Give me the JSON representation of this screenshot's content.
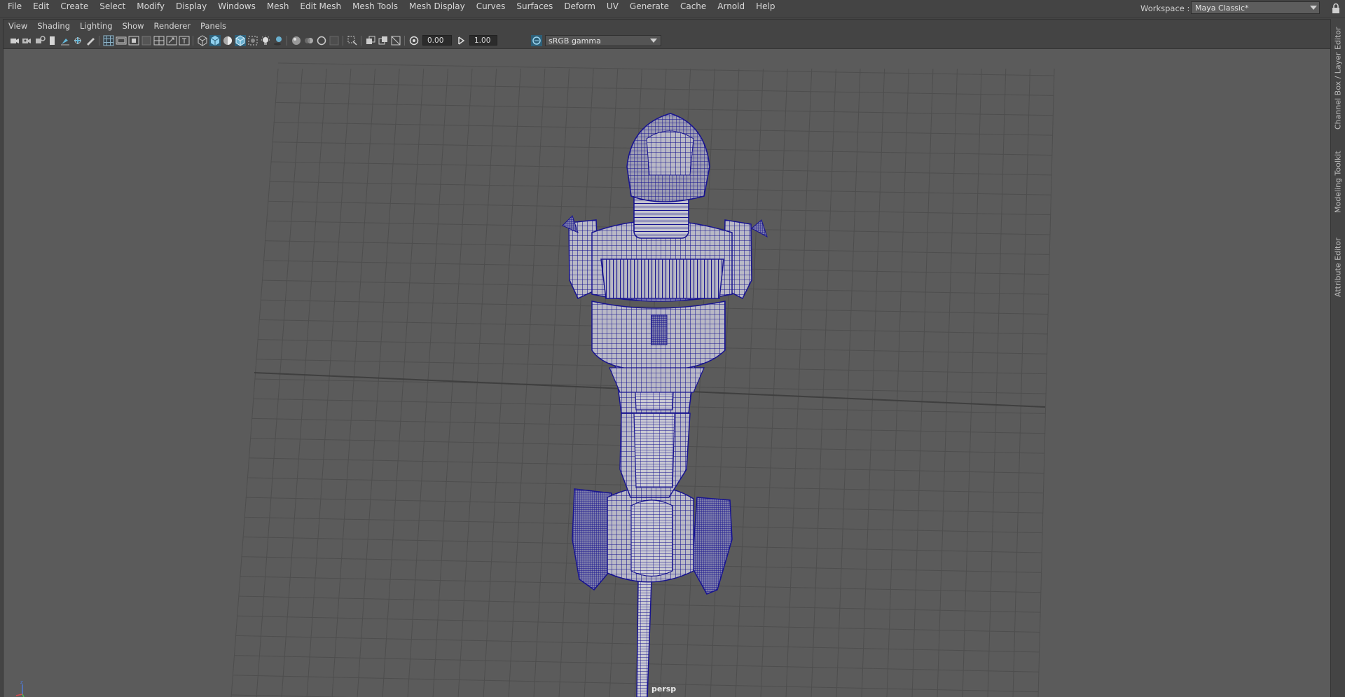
{
  "menubar": {
    "items": [
      "File",
      "Edit",
      "Create",
      "Select",
      "Modify",
      "Display",
      "Windows",
      "Mesh",
      "Edit Mesh",
      "Mesh Tools",
      "Mesh Display",
      "Curves",
      "Surfaces",
      "Deform",
      "UV",
      "Generate",
      "Cache",
      "Arnold",
      "Help"
    ],
    "workspace_label": "Workspace :",
    "workspace_value": "Maya Classic*"
  },
  "panel": {
    "menu": [
      "View",
      "Shading",
      "Lighting",
      "Show",
      "Renderer",
      "Panels"
    ],
    "exposure": "0.00",
    "gamma": "1.00",
    "color_space": "sRGB gamma",
    "camera": "persp"
  },
  "right_dock": {
    "tabs": [
      "Channel Box / Layer Editor",
      "Modeling Toolkit",
      "Attribute Editor"
    ]
  },
  "icons": {
    "toolbar": [
      "camera-icon",
      "camera-attributes-icon",
      "bookmark-icon",
      "image-plane-icon",
      "2d-pan-zoom-icon",
      "grease-pencil-icon",
      "grid-icon",
      "film-gate-icon",
      "resolution-gate-icon",
      "gate-mask-icon",
      "field-chart-icon",
      "safe-action-icon",
      "safe-title-icon",
      "wireframe-icon",
      "smooth-shade-icon",
      "default-material-icon",
      "wireframe-on-shaded-icon",
      "xray-icon",
      "use-all-lights-icon",
      "shadows-icon",
      "screen-space-ao-icon",
      "motion-blur-icon",
      "anti-aliasing-icon",
      "depth-of-field-icon",
      "isolate-select-icon",
      "xray-joints-icon",
      "xray-active-icon",
      "exposure-icon",
      "gamma-icon",
      "color-management-icon"
    ]
  },
  "colors": {
    "viewport_bg": "#5b5b5b",
    "grid": "#4d4d4d",
    "wireframe": "#18148f",
    "ui_bg": "#444444"
  }
}
